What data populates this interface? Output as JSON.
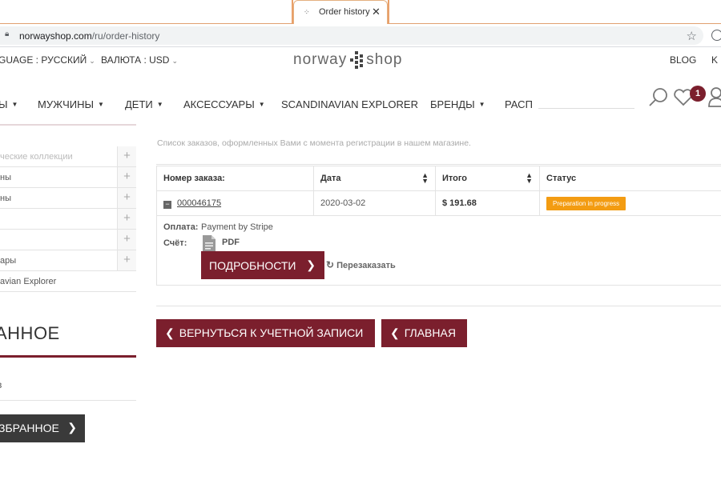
{
  "browser": {
    "tab_title": "Order history",
    "tab_close": "✕",
    "url_domain": "norwayshop.com",
    "url_path": "/ru/order-history"
  },
  "header": {
    "language_label": "GUAGE : РУССКИЙ",
    "currency_label": "ВАЛЮТА : USD",
    "logo_left": "norway",
    "logo_right": "shop",
    "blog": "BLOG",
    "cut_link": "K",
    "wishlist_count": "1"
  },
  "nav": {
    "items": [
      "Ы",
      "МУЖЧИНЫ",
      "ДЕТИ",
      "АКСЕССУАРЫ",
      "SCANDINAVIAN EXPLORER",
      "БРЕНДЫ",
      "РАСП"
    ]
  },
  "sidebar": {
    "items": [
      {
        "label": "ческие коллекции"
      },
      {
        "label": "ны"
      },
      {
        "label": "ны"
      },
      {
        "label": ""
      },
      {
        "label": ""
      },
      {
        "label": "ары"
      },
      {
        "label": "avian Explorer"
      }
    ],
    "wishlist_title": "АННОЕ",
    "wishlist_item": "в",
    "wishlist_button": "ЗБРАННОЕ"
  },
  "main": {
    "intro": "Список заказов, оформленных Вами с момента регистрации в нашем магазине.",
    "table": {
      "headers": [
        "Номер заказа:",
        "Дата",
        "Итого",
        "Статус"
      ],
      "rows": [
        {
          "order": "000046175",
          "date": "2020-03-02",
          "total": "$ 191.68",
          "status": "Preparation in progress"
        }
      ]
    },
    "details": {
      "payment_label": "Оплата:",
      "payment_value": "Payment by Stripe",
      "invoice_label": "Счёт:",
      "invoice_value": "PDF",
      "details_button": "ПОДРОБНОСТИ",
      "reorder": "Перезаказать"
    },
    "back_account": "ВЕРНУТЬСЯ К УЧЕТНОЙ ЗАПИСИ",
    "home": "ГЛАВНАЯ"
  },
  "colors": {
    "brand": "#7b1f2d",
    "status": "#f39c12"
  },
  "icons": [
    "lock-icon",
    "star-icon",
    "search-icon",
    "heart-icon",
    "user-icon",
    "pdf-icon",
    "refresh-icon",
    "chevron-right-icon",
    "chevron-left-icon",
    "plus-icon",
    "minus-icon",
    "sort-icon"
  ]
}
